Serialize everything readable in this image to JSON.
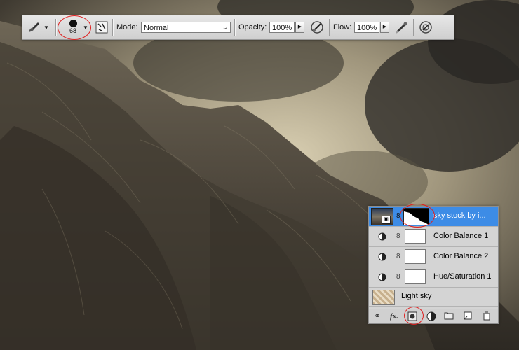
{
  "options_bar": {
    "brush_size": "68",
    "mode_label": "Mode:",
    "mode_value": "Normal",
    "opacity_label": "Opacity:",
    "opacity_value": "100%",
    "flow_label": "Flow:",
    "flow_value": "100%",
    "icons": [
      "brush-tool-icon",
      "brush-preset-icon",
      "brush-panel-icon",
      "airbrush-icon",
      "pressure-opacity-icon",
      "pressure-size-icon"
    ]
  },
  "layers": {
    "rows": [
      {
        "name": "sky stock by i...",
        "selected": true,
        "thumb": "photo-with-mask"
      },
      {
        "name": "Color Balance 1",
        "selected": false,
        "thumb": "adjustment"
      },
      {
        "name": "Color Balance 2",
        "selected": false,
        "thumb": "adjustment"
      },
      {
        "name": "Hue/Saturation 1",
        "selected": false,
        "thumb": "adjustment"
      },
      {
        "name": "Light sky",
        "selected": false,
        "thumb": "pattern"
      }
    ],
    "footer_icons": [
      "link-layers-icon",
      "fx-icon",
      "add-mask-icon",
      "adjustment-layer-icon",
      "new-group-icon",
      "new-layer-icon",
      "trash-icon"
    ],
    "fx_label": "fx."
  },
  "colors": {
    "selection": "#3d8ce6",
    "annotation": "#e01f1f"
  }
}
